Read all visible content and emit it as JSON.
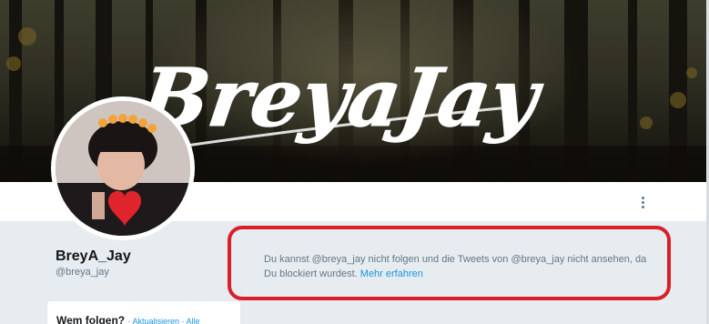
{
  "banner": {
    "logo_text": "BreyaJay"
  },
  "profile": {
    "name": "BreyA_Jay",
    "handle": "@breya_jay"
  },
  "notice": {
    "text": "Du kannst @breya_jay nicht folgen und die Tweets von @breya_jay nicht ansehen, da Du blockiert wurdest.",
    "link": "Mehr erfahren"
  },
  "who_to_follow": {
    "title": "Wem folgen?",
    "separator": " · ",
    "refresh": "Aktualisieren",
    "all": "Alle"
  },
  "colors": {
    "accent": "#1b95e0",
    "highlight_border": "#d81f2a",
    "background": "#e6ecf0"
  },
  "icons": {
    "more": "more-vertical-icon"
  }
}
